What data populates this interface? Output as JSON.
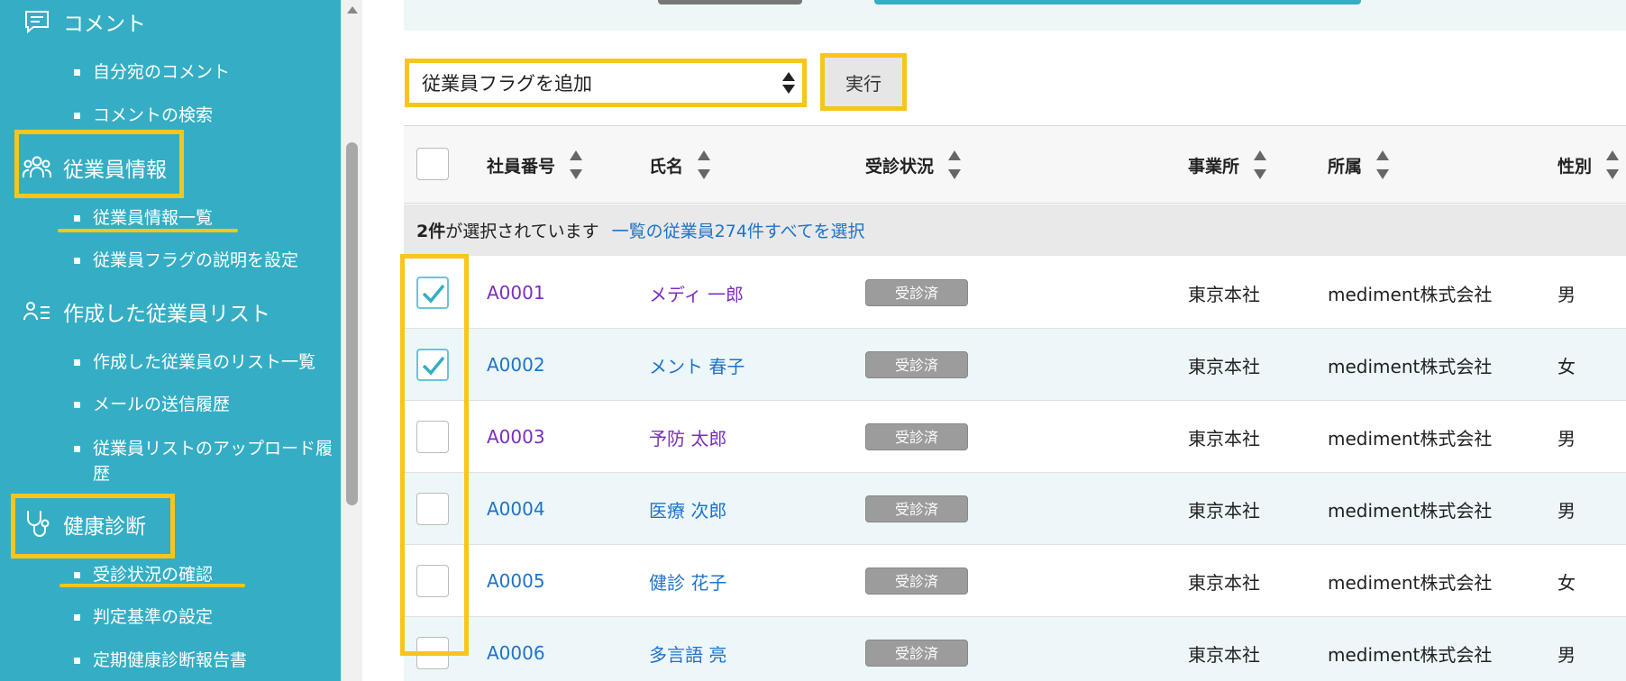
{
  "sidebar": {
    "sections": [
      {
        "label": "コメント",
        "icon": "comment-icon"
      },
      {
        "label": "従業員情報",
        "icon": "people-icon"
      },
      {
        "label": "作成した従業員リスト",
        "icon": "user-list-icon"
      },
      {
        "label": "健康診断",
        "icon": "stethoscope-icon"
      }
    ],
    "items": [
      "自分宛のコメント",
      "コメントの検索",
      "従業員情報一覧",
      "従業員フラグの説明を設定",
      "作成した従業員のリスト一覧",
      "メールの送信履歴",
      "従業員リストのアップロード履歴",
      "受診状況の確認",
      "判定基準の設定",
      "定期健康診断報告書"
    ]
  },
  "toolbar": {
    "select_value": "従業員フラグを追加",
    "exec_label": "実行"
  },
  "table": {
    "headers": [
      "社員番号",
      "氏名",
      "受診状況",
      "事業所",
      "所属",
      "性別"
    ],
    "selection": {
      "count": "2件",
      "text": "が選択されています",
      "select_all_link": "一覧の従業員274件すべてを選択"
    },
    "rows": [
      {
        "id": "A0001",
        "name": "メディ 一郎",
        "status": "受診済",
        "office": "東京本社",
        "dept": "mediment株式会社",
        "gender": "男",
        "checked": true
      },
      {
        "id": "A0002",
        "name": "メント 春子",
        "status": "受診済",
        "office": "東京本社",
        "dept": "mediment株式会社",
        "gender": "女",
        "checked": true
      },
      {
        "id": "A0003",
        "name": "予防 太郎",
        "status": "受診済",
        "office": "東京本社",
        "dept": "mediment株式会社",
        "gender": "男",
        "checked": false
      },
      {
        "id": "A0004",
        "name": "医療 次郎",
        "status": "受診済",
        "office": "東京本社",
        "dept": "mediment株式会社",
        "gender": "男",
        "checked": false
      },
      {
        "id": "A0005",
        "name": "健診 花子",
        "status": "受診済",
        "office": "東京本社",
        "dept": "mediment株式会社",
        "gender": "女",
        "checked": false
      },
      {
        "id": "A0006",
        "name": "多言語 亮",
        "status": "受診済",
        "office": "東京本社",
        "dept": "mediment株式会社",
        "gender": "男",
        "checked": false
      }
    ]
  },
  "colors": {
    "sidebar": "#35aec5",
    "highlight": "#f7c51c",
    "link": "#1f73c9",
    "visited": "#7b2fc0"
  }
}
